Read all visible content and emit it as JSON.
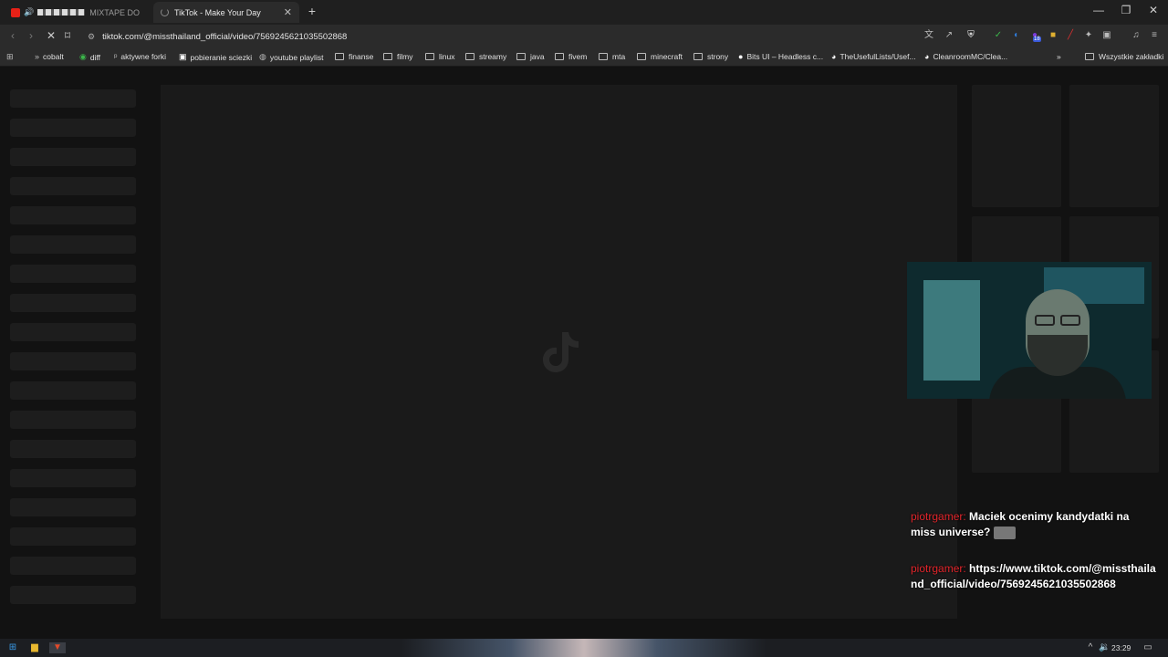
{
  "tabs": [
    {
      "label": "MIXTAPE DO N",
      "active": false
    },
    {
      "label": "TikTok - Make Your Day",
      "active": true
    }
  ],
  "window_controls": {
    "minimize": "—",
    "maximize": "❐",
    "close": "✕"
  },
  "url": "tiktok.com/@missthailand_official/video/7569245621035502868",
  "bookmarks": [
    {
      "label": "cobalt",
      "icon": "cobalt-icon"
    },
    {
      "label": "diff",
      "icon": "diff-icon"
    },
    {
      "label": "aktywne forki",
      "icon": "fork-icon"
    },
    {
      "label": "pobieranie sciezki",
      "icon": "green-check-icon"
    },
    {
      "label": "youtube playlist",
      "icon": "globe-icon"
    },
    {
      "label": "finanse",
      "icon": "folder-icon"
    },
    {
      "label": "filmy",
      "icon": "folder-icon"
    },
    {
      "label": "linux",
      "icon": "folder-icon"
    },
    {
      "label": "streamy",
      "icon": "folder-icon"
    },
    {
      "label": "java",
      "icon": "folder-icon"
    },
    {
      "label": "fivem",
      "icon": "folder-icon"
    },
    {
      "label": "mta",
      "icon": "folder-icon"
    },
    {
      "label": "minecraft",
      "icon": "folder-icon"
    },
    {
      "label": "strony",
      "icon": "folder-icon"
    },
    {
      "label": "Bits UI – Headless c...",
      "icon": "circle-icon"
    },
    {
      "label": "TheUsefulLists/Usef...",
      "icon": "github-icon"
    },
    {
      "label": "CleanroomMC/Clea...",
      "icon": "github-icon"
    }
  ],
  "bookmarks_more": "»",
  "all_bookmarks": "Wszystkie zakładki",
  "chat": [
    {
      "user": "piotrgamer:",
      "text": "Maciek ocenimy kandydatki na miss universe?"
    },
    {
      "user": "piotrgamer:",
      "text": "https://www.tiktok.com/@missthailand_official/video/7569245621035502868"
    }
  ],
  "extension_badge": "18",
  "clock": "23:29",
  "colors": {
    "chat_user": "#e2252b",
    "page_bg": "#121212",
    "skeleton": "#1d1d1d"
  }
}
